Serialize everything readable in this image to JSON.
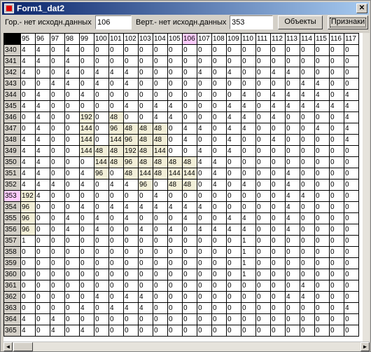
{
  "window": {
    "title": "Form1_dat2",
    "close_glyph": "✕",
    "icon": "app-icon"
  },
  "toolbar": {
    "horiz_label": "Гор.- нет исходн.данных",
    "horiz_value": "106",
    "vert_label": "Верт.- нет исходн.данных",
    "vert_value": "353",
    "objects_button": "Объекты",
    "features_button": "Признаки"
  },
  "grid": {
    "columns": [
      "95",
      "96",
      "97",
      "98",
      "99",
      "100",
      "101",
      "102",
      "103",
      "104",
      "105",
      "106",
      "107",
      "108",
      "109",
      "110",
      "111",
      "112",
      "113",
      "114",
      "115",
      "116",
      "117"
    ],
    "selected_column": "106",
    "selected_row": "353",
    "rows": [
      {
        "label": "340",
        "cells": [
          "4",
          "4",
          "0",
          "4",
          "0",
          "0",
          "0",
          "0",
          "0",
          "0",
          "0",
          "0",
          "0",
          "0",
          "0",
          "0",
          "0",
          "0",
          "0",
          "0",
          "0",
          "0",
          "0"
        ]
      },
      {
        "label": "341",
        "cells": [
          "4",
          "4",
          "0",
          "4",
          "0",
          "0",
          "0",
          "0",
          "0",
          "0",
          "0",
          "0",
          "0",
          "0",
          "0",
          "0",
          "0",
          "0",
          "0",
          "0",
          "0",
          "0",
          "0"
        ]
      },
      {
        "label": "342",
        "cells": [
          "4",
          "0",
          "0",
          "4",
          "0",
          "4",
          "4",
          "4",
          "0",
          "0",
          "0",
          "0",
          "4",
          "0",
          "4",
          "0",
          "0",
          "4",
          "4",
          "0",
          "0",
          "0",
          "0"
        ]
      },
      {
        "label": "343",
        "cells": [
          "0",
          "0",
          "4",
          "4",
          "0",
          "4",
          "0",
          "4",
          "0",
          "0",
          "0",
          "0",
          "0",
          "0",
          "0",
          "0",
          "0",
          "0",
          "0",
          "4",
          "4",
          "0",
          "0"
        ]
      },
      {
        "label": "344",
        "cells": [
          "0",
          "4",
          "0",
          "0",
          "4",
          "0",
          "0",
          "0",
          "0",
          "0",
          "0",
          "0",
          "0",
          "0",
          "0",
          "4",
          "0",
          "4",
          "4",
          "4",
          "4",
          "0",
          "4"
        ]
      },
      {
        "label": "345",
        "cells": [
          "4",
          "4",
          "0",
          "0",
          "0",
          "0",
          "0",
          "4",
          "0",
          "4",
          "4",
          "0",
          "0",
          "0",
          "4",
          "4",
          "0",
          "4",
          "4",
          "4",
          "4",
          "4",
          "4"
        ]
      },
      {
        "label": "346",
        "cells": [
          "0",
          "4",
          "0",
          "0",
          "192",
          "0",
          "48",
          "0",
          "0",
          "4",
          "4",
          "0",
          "0",
          "0",
          "4",
          "4",
          "0",
          "4",
          "0",
          "0",
          "0",
          "0",
          "4"
        ]
      },
      {
        "label": "347",
        "cells": [
          "0",
          "4",
          "0",
          "0",
          "144",
          "0",
          "96",
          "48",
          "48",
          "48",
          "0",
          "4",
          "4",
          "0",
          "4",
          "4",
          "0",
          "0",
          "0",
          "0",
          "4",
          "0",
          "4"
        ]
      },
      {
        "label": "348",
        "cells": [
          "4",
          "4",
          "0",
          "0",
          "144",
          "0",
          "144",
          "96",
          "48",
          "48",
          "0",
          "4",
          "0",
          "0",
          "4",
          "0",
          "0",
          "4",
          "0",
          "0",
          "0",
          "0",
          "4"
        ]
      },
      {
        "label": "349",
        "cells": [
          "4",
          "4",
          "0",
          "0",
          "144",
          "48",
          "48",
          "192",
          "48",
          "144",
          "0",
          "0",
          "4",
          "0",
          "4",
          "0",
          "0",
          "0",
          "0",
          "0",
          "0",
          "0",
          "0"
        ]
      },
      {
        "label": "350",
        "cells": [
          "4",
          "4",
          "0",
          "0",
          "0",
          "144",
          "48",
          "96",
          "48",
          "48",
          "48",
          "48",
          "4",
          "4",
          "0",
          "0",
          "0",
          "0",
          "0",
          "0",
          "0",
          "0",
          "0"
        ]
      },
      {
        "label": "351",
        "cells": [
          "4",
          "4",
          "0",
          "0",
          "4",
          "96",
          "0",
          "48",
          "144",
          "48",
          "144",
          "144",
          "0",
          "4",
          "0",
          "0",
          "0",
          "0",
          "4",
          "0",
          "0",
          "0",
          "0"
        ]
      },
      {
        "label": "352",
        "cells": [
          "4",
          "4",
          "4",
          "0",
          "4",
          "0",
          "4",
          "4",
          "96",
          "0",
          "48",
          "48",
          "0",
          "4",
          "0",
          "4",
          "0",
          "0",
          "4",
          "0",
          "0",
          "0",
          "0"
        ]
      },
      {
        "label": "353",
        "cells": [
          "192",
          "4",
          "0",
          "0",
          "0",
          "0",
          "0",
          "0",
          "0",
          "4",
          "0",
          "0",
          "0",
          "0",
          "0",
          "0",
          "0",
          "0",
          "4",
          "4",
          "0",
          "0",
          "0"
        ]
      },
      {
        "label": "354",
        "cells": [
          "96",
          "0",
          "0",
          "0",
          "4",
          "0",
          "4",
          "4",
          "4",
          "4",
          "4",
          "4",
          "4",
          "0",
          "0",
          "0",
          "0",
          "0",
          "4",
          "0",
          "0",
          "0",
          "0"
        ]
      },
      {
        "label": "355",
        "cells": [
          "96",
          "0",
          "0",
          "4",
          "0",
          "4",
          "0",
          "4",
          "0",
          "0",
          "0",
          "4",
          "0",
          "0",
          "4",
          "4",
          "0",
          "0",
          "4",
          "0",
          "0",
          "0",
          "0"
        ]
      },
      {
        "label": "356",
        "cells": [
          "96",
          "0",
          "0",
          "4",
          "0",
          "4",
          "0",
          "0",
          "4",
          "0",
          "4",
          "0",
          "4",
          "4",
          "4",
          "4",
          "0",
          "0",
          "4",
          "0",
          "0",
          "0",
          "0"
        ]
      },
      {
        "label": "357",
        "cells": [
          "1",
          "0",
          "0",
          "0",
          "0",
          "0",
          "0",
          "0",
          "0",
          "0",
          "0",
          "0",
          "0",
          "0",
          "0",
          "1",
          "0",
          "0",
          "0",
          "0",
          "0",
          "0",
          "0"
        ]
      },
      {
        "label": "358",
        "cells": [
          "0",
          "0",
          "0",
          "0",
          "0",
          "0",
          "0",
          "0",
          "0",
          "0",
          "0",
          "0",
          "0",
          "0",
          "0",
          "1",
          "0",
          "0",
          "0",
          "0",
          "0",
          "0",
          "0"
        ]
      },
      {
        "label": "359",
        "cells": [
          "0",
          "0",
          "0",
          "0",
          "0",
          "0",
          "0",
          "0",
          "0",
          "0",
          "0",
          "0",
          "0",
          "0",
          "0",
          "1",
          "0",
          "0",
          "0",
          "0",
          "0",
          "0",
          "0"
        ]
      },
      {
        "label": "360",
        "cells": [
          "0",
          "0",
          "0",
          "0",
          "0",
          "0",
          "0",
          "0",
          "0",
          "0",
          "0",
          "0",
          "0",
          "0",
          "0",
          "1",
          "0",
          "0",
          "0",
          "0",
          "0",
          "0",
          "0"
        ]
      },
      {
        "label": "361",
        "cells": [
          "0",
          "0",
          "0",
          "0",
          "0",
          "0",
          "0",
          "0",
          "0",
          "0",
          "0",
          "0",
          "0",
          "0",
          "0",
          "0",
          "0",
          "0",
          "0",
          "4",
          "0",
          "0",
          "0"
        ]
      },
      {
        "label": "362",
        "cells": [
          "0",
          "0",
          "0",
          "0",
          "0",
          "4",
          "0",
          "4",
          "4",
          "0",
          "0",
          "0",
          "0",
          "0",
          "0",
          "0",
          "0",
          "0",
          "4",
          "4",
          "0",
          "0",
          "0"
        ]
      },
      {
        "label": "363",
        "cells": [
          "0",
          "0",
          "0",
          "0",
          "4",
          "0",
          "4",
          "4",
          "4",
          "0",
          "0",
          "0",
          "0",
          "0",
          "0",
          "0",
          "0",
          "0",
          "0",
          "0",
          "0",
          "0",
          "4"
        ]
      },
      {
        "label": "364",
        "cells": [
          "4",
          "0",
          "4",
          "0",
          "0",
          "0",
          "0",
          "0",
          "0",
          "0",
          "0",
          "0",
          "0",
          "0",
          "0",
          "0",
          "0",
          "0",
          "0",
          "0",
          "0",
          "0",
          "0"
        ]
      },
      {
        "label": "365",
        "cells": [
          "4",
          "0",
          "4",
          "0",
          "4",
          "0",
          "0",
          "0",
          "0",
          "0",
          "0",
          "0",
          "0",
          "0",
          "0",
          "0",
          "0",
          "0",
          "0",
          "0",
          "0",
          "0",
          "0"
        ]
      }
    ]
  },
  "scrollbars": {
    "left_arrow": "◄",
    "right_arrow": "►"
  }
}
